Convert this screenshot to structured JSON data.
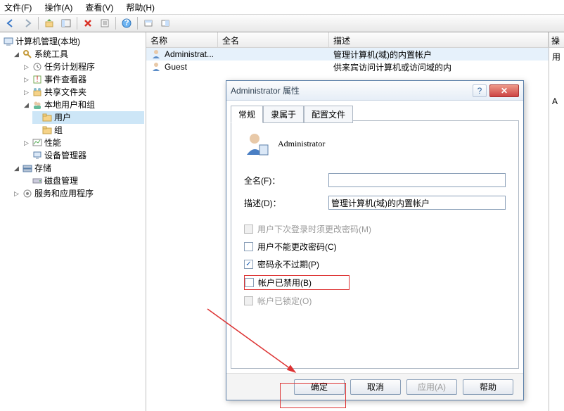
{
  "menu": {
    "file": "文件(F)",
    "action": "操作(A)",
    "view": "查看(V)",
    "help": "帮助(H)"
  },
  "tree": {
    "root": "计算机管理(本地)",
    "systemTools": "系统工具",
    "taskScheduler": "任务计划程序",
    "eventViewer": "事件查看器",
    "sharedFolders": "共享文件夹",
    "localUsersGroups": "本地用户和组",
    "users": "用户",
    "groups": "组",
    "performance": "性能",
    "deviceManager": "设备管理器",
    "storage": "存储",
    "diskMgmt": "磁盘管理",
    "servicesApps": "服务和应用程序"
  },
  "list": {
    "cols": {
      "name": "名称",
      "fullname": "全名",
      "desc": "描述"
    },
    "rows": [
      {
        "name": "Administrat...",
        "full": "",
        "desc": "管理计算机(域)的内置帐户"
      },
      {
        "name": "Guest",
        "full": "",
        "desc": "供来宾访问计算机或访问域的内"
      }
    ]
  },
  "rightHdr": "操",
  "rightItem": "用",
  "rightItem2": "A",
  "dialog": {
    "title": "Administrator 属性",
    "tabs": {
      "general": "常规",
      "memberOf": "隶属于",
      "profile": "配置文件"
    },
    "userName": "Administrator",
    "fullNameLbl": "全名(F)：",
    "descLbl": "描述(D)：",
    "descVal": "管理计算机(域)的内置帐户",
    "chkMustChange": "用户下次登录时须更改密码(M)",
    "chkCannotChange": "用户不能更改密码(C)",
    "chkNeverExpire": "密码永不过期(P)",
    "chkDisabled": "帐户已禁用(B)",
    "chkLocked": "帐户已锁定(O)",
    "ok": "确定",
    "cancel": "取消",
    "apply": "应用(A)",
    "help": "帮助"
  }
}
